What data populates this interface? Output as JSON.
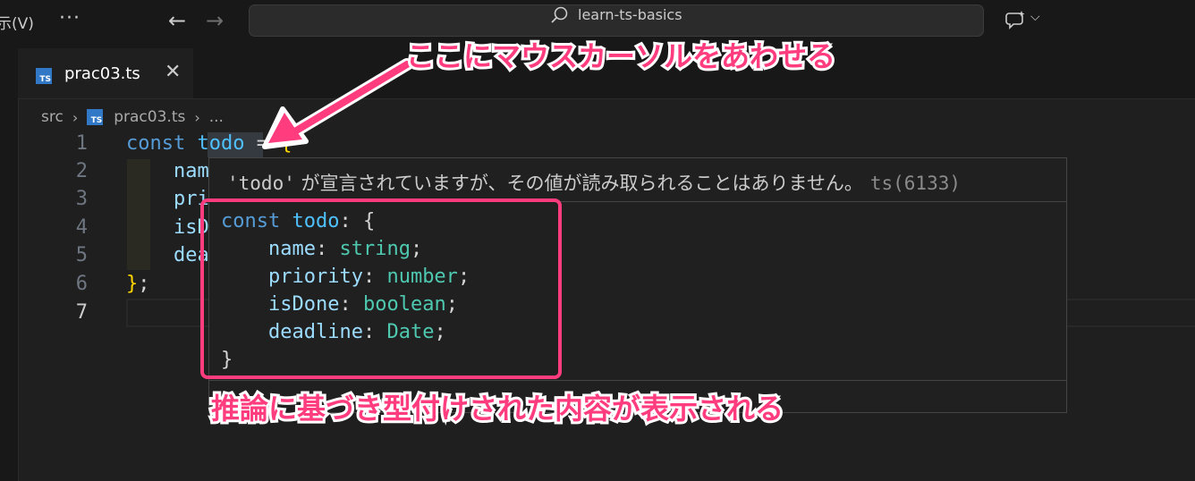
{
  "titlebar": {
    "menu_view": "示(V)",
    "more": "···",
    "search_text": "learn-ts-basics"
  },
  "tab": {
    "label": "prac03.ts",
    "icon_text": "TS",
    "close": "✕"
  },
  "breadcrumb": {
    "folder": "src",
    "file": "prac03.ts",
    "ellipsis": "..."
  },
  "editor": {
    "line_numbers": [
      "1",
      "2",
      "3",
      "4",
      "5",
      "6",
      "7"
    ],
    "line1": {
      "kw": "const",
      "var": "todo",
      "op": "=",
      "brace": "{"
    },
    "line2": "name",
    "line3": "prio",
    "line4": "isDo",
    "line5": "dead",
    "line6": {
      "brace": "}",
      "semi": ";"
    }
  },
  "hover": {
    "message_code": "'todo'",
    "message_text": " が宣言されていますが、その値が読み取られることはありません。",
    "error_code": "ts(6133)",
    "type_const": "const",
    "type_name": "todo",
    "type_open": ": {",
    "fields": [
      {
        "name": "name",
        "type": "string"
      },
      {
        "name": "priority",
        "type": "number"
      },
      {
        "name": "isDone",
        "type": "boolean"
      },
      {
        "name": "deadline",
        "type": "Date"
      }
    ],
    "type_close": "}"
  },
  "annotations": {
    "top_note": "ここにマウスカーソルをあわせる",
    "bottom_note": "推論に基づき型付けされた内容が表示される"
  },
  "colors": {
    "accent_annotation": "#ff3c7d",
    "keyword": "#569cd6",
    "type": "#4ec9b0",
    "ts_badge": "#3178c6"
  }
}
